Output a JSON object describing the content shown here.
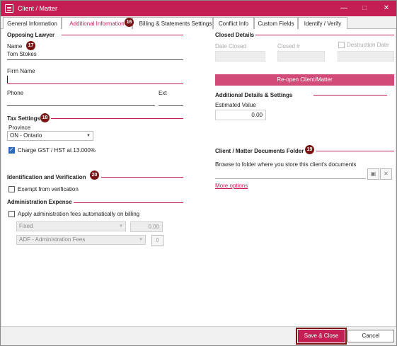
{
  "window": {
    "title": "Client / Matter"
  },
  "tabs": [
    {
      "label": "General Information"
    },
    {
      "label": "Additional Information"
    },
    {
      "label": "Billing & Statements Settings"
    },
    {
      "label": "Conflict Info"
    },
    {
      "label": "Custom Fields"
    },
    {
      "label": "Identify / Verify"
    }
  ],
  "badges": {
    "tab": "16",
    "opposing": "17",
    "tax": "18",
    "folder": "19",
    "verification": "20"
  },
  "opposing_lawyer": {
    "title": "Opposing Lawyer",
    "name_label": "Name",
    "name_value": "Tom Stokes",
    "firm_label": "Firm Name",
    "phone_label": "Phone",
    "ext_label": "Ext"
  },
  "tax_settings": {
    "title": "Tax Settings",
    "province_label": "Province",
    "province_value": "ON - Ontario",
    "gst_label": "Charge GST / HST at 13.000%",
    "gst_checked": true
  },
  "verification": {
    "title": "Identification and Verification",
    "exempt_label": "Exempt from verification",
    "exempt_checked": false
  },
  "admin_expense": {
    "title": "Administration Expense",
    "apply_label": "Apply administration fees automatically on billing",
    "apply_checked": false,
    "fee_type": "Fixed",
    "fee_amount": "0.00",
    "fee_code": "ADF - Administration Fees"
  },
  "closed_details": {
    "title": "Closed Details",
    "date_closed_label": "Date Closed",
    "closed_num_label": "Closed #",
    "destruction_label": "Destruction Date",
    "reopen_label": "Re-open Client/Matter"
  },
  "additional_details": {
    "title": "Additional Details & Settings",
    "estimated_label": "Estimated Value",
    "estimated_value": "0.00"
  },
  "documents_folder": {
    "title": "Client / Matter Documents Folder",
    "browse_text": "Browse to folder where you store this client's documents",
    "more_options": "More options"
  },
  "footer": {
    "save_label": "Save & Close",
    "cancel_label": "Cancel"
  },
  "colors": {
    "accent": "#c41f55",
    "badge": "#7a1515",
    "checkbox": "#2b6cb0"
  }
}
